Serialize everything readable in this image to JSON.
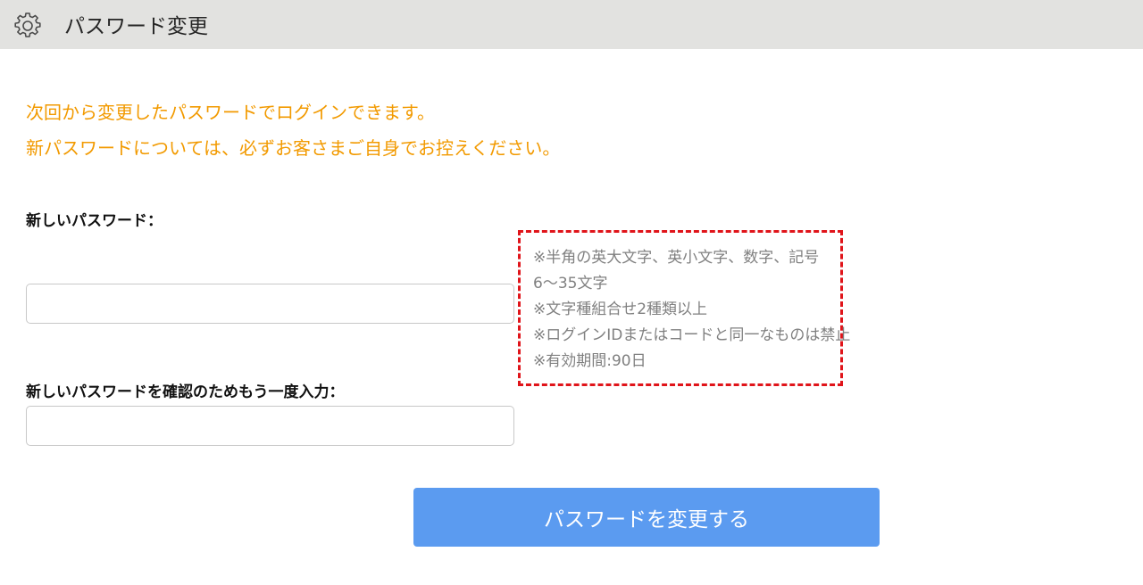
{
  "header": {
    "title": "パスワード変更",
    "icon": "gear-icon"
  },
  "notice": {
    "line1": "次回から変更したパスワードでログインできます。",
    "line2": "新パスワードについては、必ずお客さまご自身でお控えください。",
    "color": "#f29a00"
  },
  "form": {
    "new_password_label": "新しいパスワード：",
    "new_password_value": "",
    "confirm_password_label": "新しいパスワードを確認のためもう一度入力：",
    "confirm_password_value": ""
  },
  "rules": {
    "items": [
      "※半角の英大文字、英小文字、数字、記号",
      "6～35文字",
      "※文字種組合せ2種類以上",
      "※ログインIDまたはコードと同一なものは禁止",
      "※有効期間:90日"
    ],
    "border_color": "#e0141a"
  },
  "submit": {
    "label": "パスワードを変更する",
    "color": "#5b9bf0"
  }
}
